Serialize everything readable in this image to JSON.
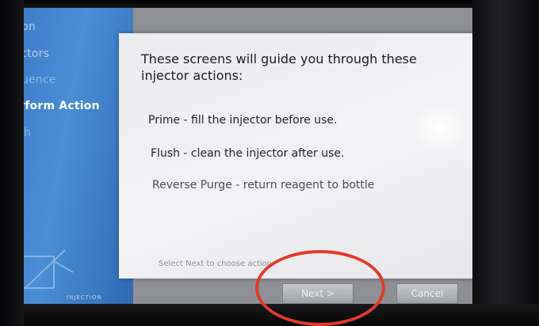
{
  "sidebar": {
    "items": [
      {
        "label": "Action",
        "state": "done"
      },
      {
        "label": "Injectors",
        "state": "done"
      },
      {
        "label": "Sequence",
        "state": "pending"
      },
      {
        "label": "Perform Action",
        "state": "active"
      },
      {
        "label": "Finish",
        "state": "pending"
      }
    ],
    "footer": "INJECTION"
  },
  "dialog": {
    "intro": "These screens will guide you through these injector actions:",
    "actions": [
      {
        "name": "Prime",
        "text": "Prime -  fill the injector before use."
      },
      {
        "name": "Flush",
        "text": "Flush  - clean the injector after use."
      },
      {
        "name": "Reverse Purge",
        "text": "Reverse Purge  - return reagent to bottle"
      }
    ],
    "hint": "Select Next to choose action."
  },
  "buttons": {
    "next": "Next >",
    "cancel": "Cancel"
  },
  "colors": {
    "sidebar_blue": "#4a8ed6",
    "highlight_ring": "#e23a2a"
  }
}
